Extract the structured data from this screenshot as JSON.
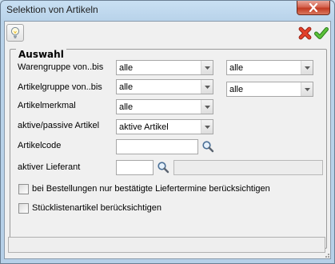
{
  "window": {
    "title": "Selektion von Artikeln"
  },
  "toolbar": {
    "hint_icon": "lightbulb-icon",
    "cancel_icon": "red-x-icon",
    "ok_icon": "green-check-icon"
  },
  "group": {
    "legend": "Auswahl",
    "warengruppe": {
      "label": "Warengruppe von..bis",
      "from": "alle",
      "to": "alle"
    },
    "artikelgruppe": {
      "label": "Artikelgruppe von..bis",
      "from": "alle",
      "to": "alle"
    },
    "artikelmerkmal": {
      "label": "Artikelmerkmal",
      "value": "alle"
    },
    "aktiv_passiv": {
      "label": "aktive/passive Artikel",
      "value": "aktive Artikel"
    },
    "artikelcode": {
      "label": "Artikelcode",
      "value": ""
    },
    "lieferant": {
      "label": "aktiver Lieferant",
      "value": "",
      "name": ""
    },
    "check_bestellungen": {
      "label": "bei Bestellungen nur bestätigte Liefertermine berücksichtigen",
      "checked": false
    },
    "check_stueckliste": {
      "label": "Stücklistenartikel berücksichtigen",
      "checked": false
    }
  },
  "colors": {
    "title_bg": "#c9e0f3",
    "client_bg": "#f0f0f0",
    "close_red": "#c23a22"
  }
}
